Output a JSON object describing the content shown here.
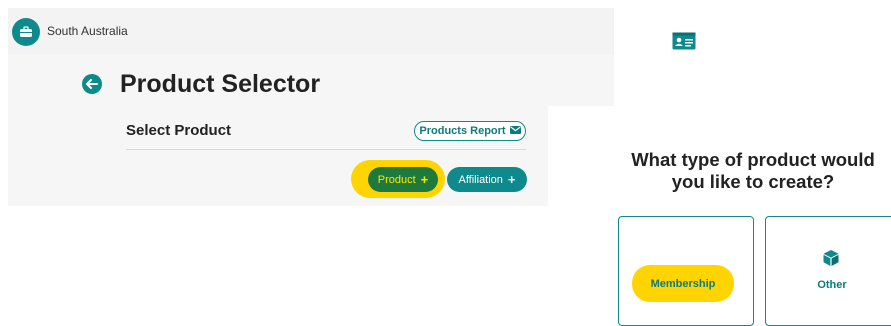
{
  "org": {
    "name": "South Australia",
    "icon": "briefcase-icon"
  },
  "page": {
    "title": "Product Selector",
    "back_icon": "arrow-left-icon"
  },
  "select_section": {
    "title": "Select Product",
    "report_button": {
      "label": "Products Report",
      "icon": "envelope-icon"
    },
    "product_button": {
      "label": "Product",
      "icon": "plus-icon"
    },
    "affiliation_button": {
      "label": "Affiliation",
      "icon": "plus-icon"
    }
  },
  "create_dialog": {
    "question": "What type of product would you like to create?",
    "options": [
      {
        "label": "Membership",
        "icon": "id-card-icon"
      },
      {
        "label": "Other",
        "icon": "box-icon"
      }
    ]
  },
  "colors": {
    "teal": "#0f8a8c",
    "highlight_yellow": "#ffd400",
    "product_green": "#1d7a3a"
  }
}
